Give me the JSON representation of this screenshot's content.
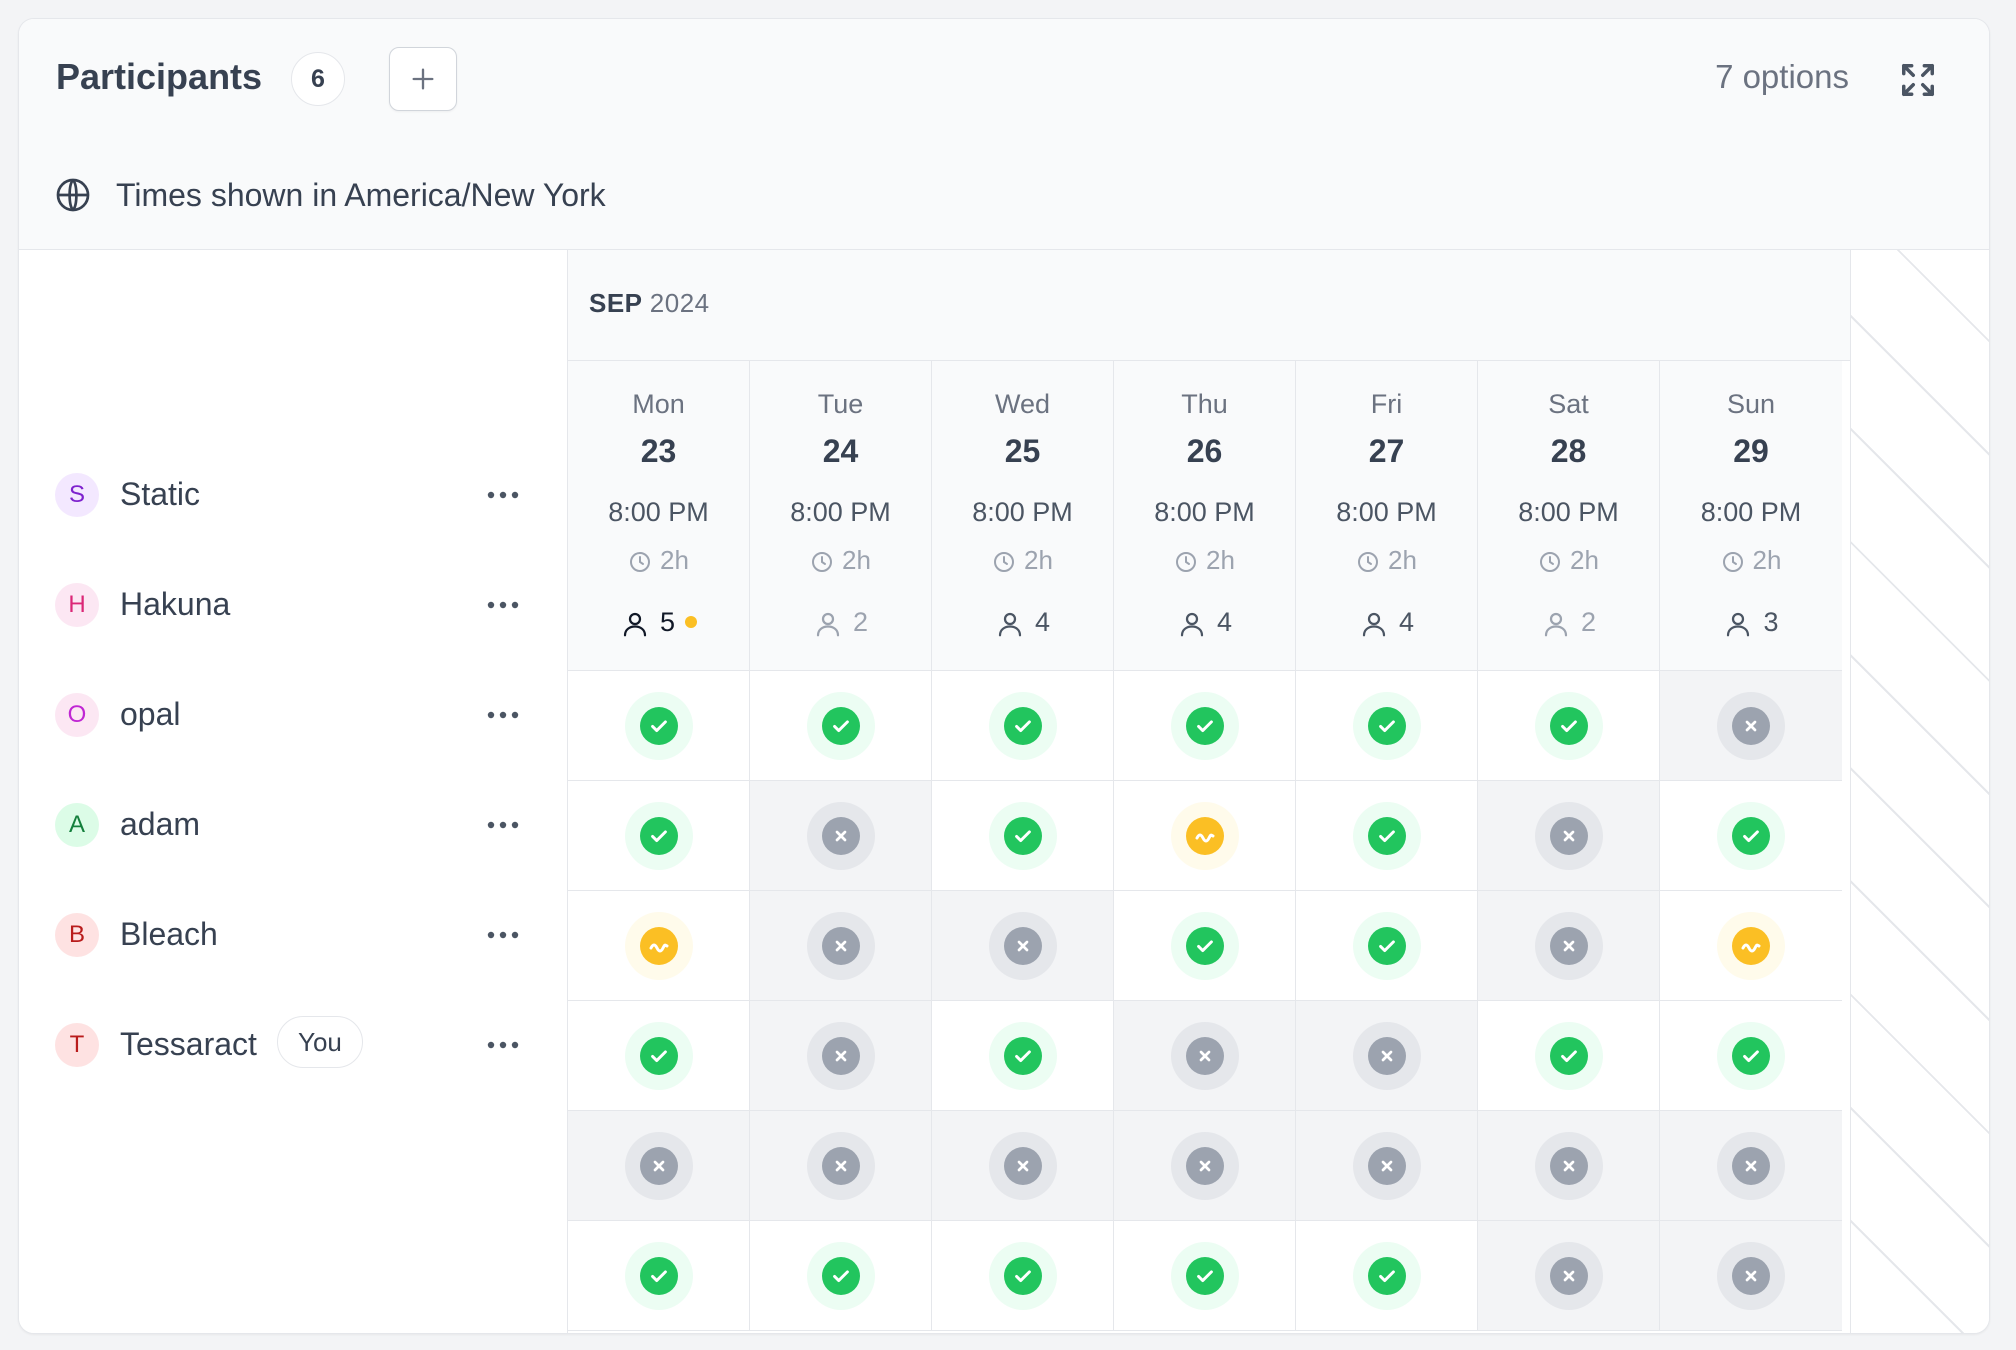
{
  "header": {
    "title": "Participants",
    "participant_count": "6",
    "options_label": "7 options"
  },
  "timezone": {
    "label": "Times shown in America/New York"
  },
  "calendar": {
    "month": "SEP",
    "year": "2024",
    "days": [
      {
        "dow": "Mon",
        "date": "23",
        "time": "8:00 PM",
        "duration": "2h",
        "votes": "5",
        "top": true
      },
      {
        "dow": "Tue",
        "date": "24",
        "time": "8:00 PM",
        "duration": "2h",
        "votes": "2",
        "top": false
      },
      {
        "dow": "Wed",
        "date": "25",
        "time": "8:00 PM",
        "duration": "2h",
        "votes": "4",
        "top": false
      },
      {
        "dow": "Thu",
        "date": "26",
        "time": "8:00 PM",
        "duration": "2h",
        "votes": "4",
        "top": false
      },
      {
        "dow": "Fri",
        "date": "27",
        "time": "8:00 PM",
        "duration": "2h",
        "votes": "4",
        "top": false
      },
      {
        "dow": "Sat",
        "date": "28",
        "time": "8:00 PM",
        "duration": "2h",
        "votes": "2",
        "top": false
      },
      {
        "dow": "Sun",
        "date": "29",
        "time": "8:00 PM",
        "duration": "2h",
        "votes": "3",
        "top": false
      }
    ]
  },
  "participants": [
    {
      "initial": "S",
      "name": "Static",
      "avatar_bg": "#f3e8ff",
      "avatar_fg": "#7e22ce",
      "you": false,
      "votes": [
        "yes",
        "yes",
        "yes",
        "yes",
        "yes",
        "yes",
        "no"
      ]
    },
    {
      "initial": "H",
      "name": "Hakuna",
      "avatar_bg": "#fce7f3",
      "avatar_fg": "#db2777",
      "you": false,
      "votes": [
        "yes",
        "no",
        "yes",
        "maybe",
        "yes",
        "no",
        "yes"
      ]
    },
    {
      "initial": "O",
      "name": "opal",
      "avatar_bg": "#fce7f3",
      "avatar_fg": "#c026d3",
      "you": false,
      "votes": [
        "maybe",
        "no",
        "no",
        "yes",
        "yes",
        "no",
        "maybe"
      ]
    },
    {
      "initial": "A",
      "name": "adam",
      "avatar_bg": "#dcfce7",
      "avatar_fg": "#15803d",
      "you": false,
      "votes": [
        "yes",
        "no",
        "yes",
        "no",
        "no",
        "yes",
        "yes"
      ]
    },
    {
      "initial": "B",
      "name": "Bleach",
      "avatar_bg": "#fee2e2",
      "avatar_fg": "#b91c1c",
      "you": false,
      "votes": [
        "no",
        "no",
        "no",
        "no",
        "no",
        "no",
        "no"
      ]
    },
    {
      "initial": "T",
      "name": "Tessaract",
      "avatar_bg": "#fee2e2",
      "avatar_fg": "#b91c1c",
      "you": true,
      "you_label": "You",
      "votes": [
        "yes",
        "yes",
        "yes",
        "yes",
        "yes",
        "no",
        "no"
      ]
    }
  ],
  "colors": {
    "yes": "#22c55e",
    "maybe": "#fbbf24",
    "no": "#9ca3af"
  },
  "icons": {
    "add": "plus-icon",
    "expand": "expand-icon",
    "timezone": "globe-icon",
    "duration": "clock-icon",
    "votes": "user-icon",
    "more": "ellipsis-icon"
  }
}
